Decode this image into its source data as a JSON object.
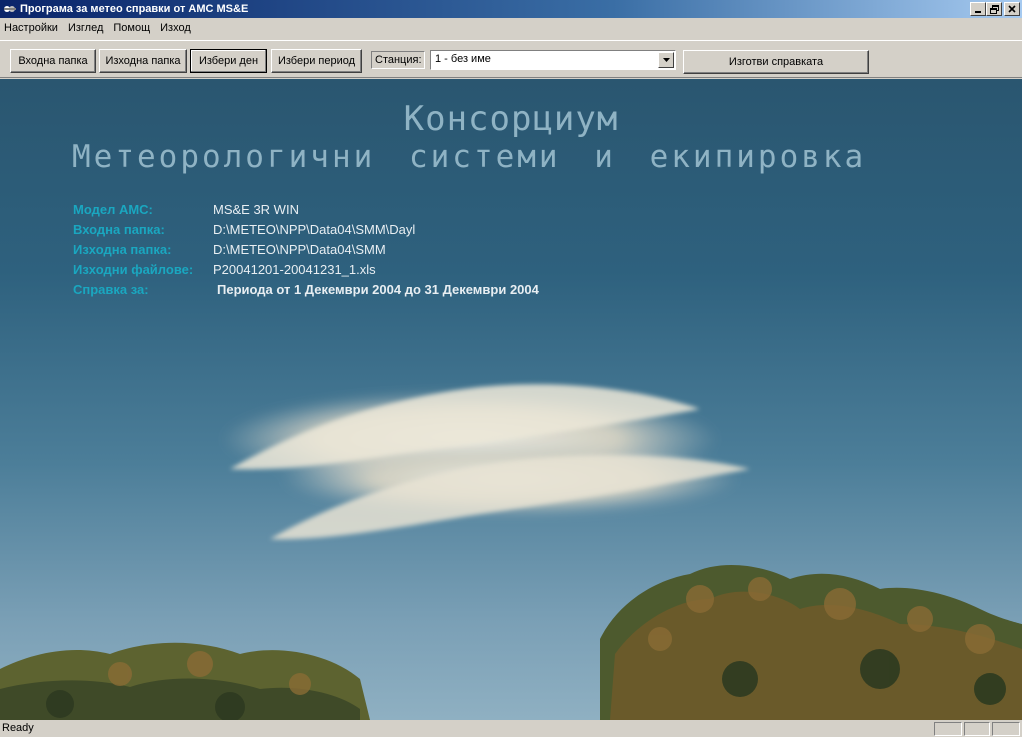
{
  "window": {
    "title": "Програма за метео справки от АМС MS&E"
  },
  "menu": {
    "items": [
      "Настройки",
      "Изглед",
      "Помощ",
      "Изход"
    ]
  },
  "toolbar": {
    "input_folder": "Входна папка",
    "output_folder": "Изходна папка",
    "select_day": "Избери ден",
    "select_period": "Избери период",
    "station_label": "Станция:",
    "station_value": "1 - без име",
    "generate_report": "Изготви справката"
  },
  "splash": {
    "title": "Консорциум",
    "subtitle": "Метеорологични системи и екипировка"
  },
  "info": {
    "rows": [
      {
        "label": "Модел АМС:",
        "value": "MS&E 3R WIN"
      },
      {
        "label": "Входна папка:",
        "value": "D:\\METEO\\NPP\\Data04\\SMM\\Dayl"
      },
      {
        "label": "Изходна папка:",
        "value": "D:\\METEO\\NPP\\Data04\\SMM"
      },
      {
        "label": "Изходни файлове:",
        "value": "P20041201-20041231_1.xls"
      },
      {
        "label": "Справка за:",
        "value": "Периода от 1  Декември  2004 до 31  Декември  2004"
      }
    ]
  },
  "status": {
    "text": "Ready"
  },
  "icons": {
    "app": "app-icon",
    "minimize": "minimize-icon",
    "restore": "restore-icon",
    "close": "close-icon",
    "dropdown": "chevron-down-icon"
  }
}
